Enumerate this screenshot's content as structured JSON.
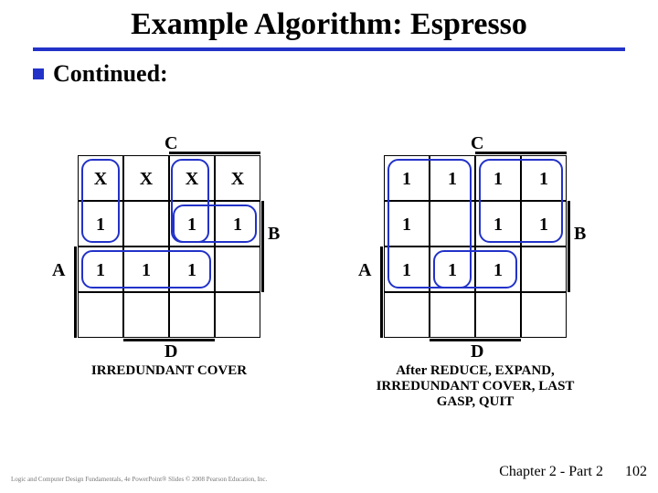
{
  "title": "Example Algorithm: Espresso",
  "bullet": "Continued:",
  "axis": {
    "C": "C",
    "B": "B",
    "A": "A",
    "D": "D"
  },
  "left": {
    "caption": "IRREDUNDANT COVER",
    "cells": {
      "r0c0": "X",
      "r0c1": "X",
      "r0c2": "X",
      "r0c3": "X",
      "r1c0": "1",
      "r1c1": "",
      "r1c2": "1",
      "r1c3": "1",
      "r2c0": "1",
      "r2c1": "1",
      "r2c2": "1",
      "r2c3": "",
      "r3c0": "",
      "r3c1": "",
      "r3c2": "",
      "r3c3": ""
    }
  },
  "right": {
    "caption": "After REDUCE, EXPAND, IRREDUNDANT COVER, LAST GASP, QUIT",
    "cells": {
      "r0c0": "1",
      "r0c1": "1",
      "r0c2": "1",
      "r0c3": "1",
      "r1c0": "1",
      "r1c1": "",
      "r1c2": "1",
      "r1c3": "1",
      "r2c0": "1",
      "r2c1": "1",
      "r2c2": "1",
      "r2c3": "",
      "r3c0": "",
      "r3c1": "",
      "r3c2": "",
      "r3c3": ""
    }
  },
  "footer": "Chapter 2 - Part 2",
  "page": "102",
  "copyright": "Logic and Computer Design Fundamentals, 4e\nPowerPoint® Slides\n© 2008 Pearson Education, Inc."
}
